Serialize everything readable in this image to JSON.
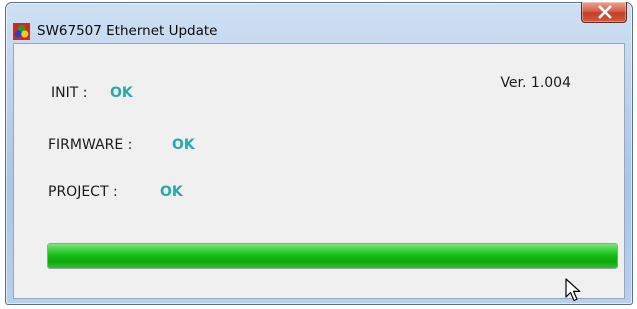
{
  "window": {
    "title": "SW67507 Ethernet Update",
    "icon": "app-logo-icon",
    "close_icon": "close-icon"
  },
  "content": {
    "version": "Ver. 1.004",
    "rows": [
      {
        "label": "INIT :",
        "status": "OK"
      },
      {
        "label": "FIRMWARE :",
        "status": "OK"
      },
      {
        "label": "PROJECT :",
        "status": "OK"
      }
    ],
    "status_color": "#27a9a9",
    "progress": 1.0
  }
}
